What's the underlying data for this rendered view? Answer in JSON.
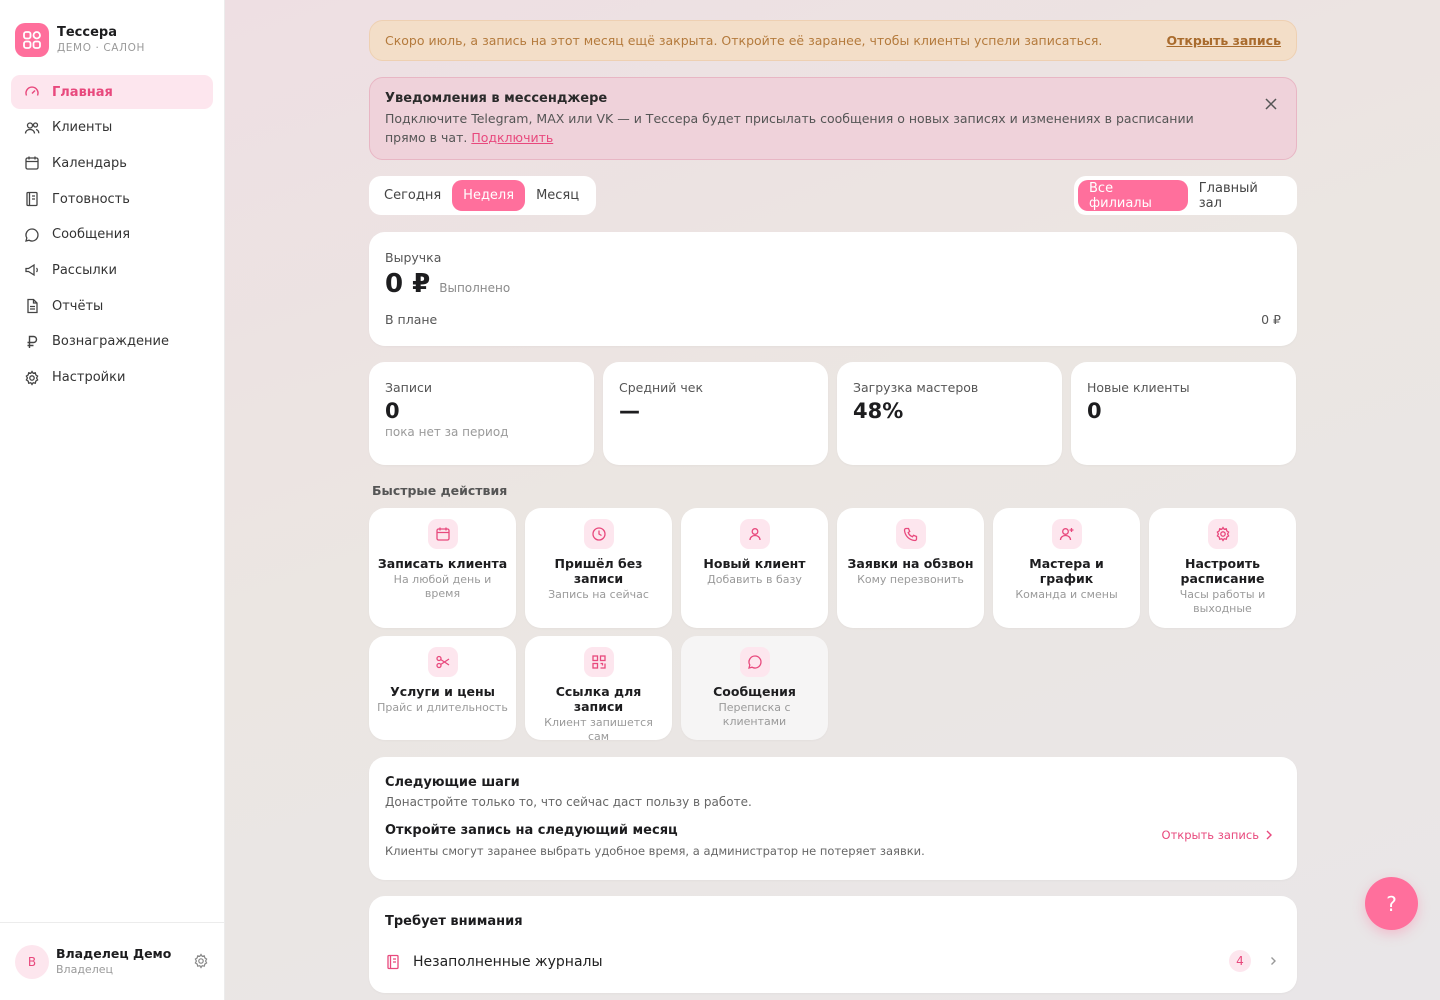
{
  "brand": {
    "name": "Тессера",
    "subtitle": "ДЕМО · САЛОН"
  },
  "nav": {
    "items": [
      {
        "label": "Главная",
        "icon": "gauge-icon",
        "active": true
      },
      {
        "label": "Клиенты",
        "icon": "users-icon"
      },
      {
        "label": "Календарь",
        "icon": "calendar-icon"
      },
      {
        "label": "Готовность",
        "icon": "notebook-icon"
      },
      {
        "label": "Сообщения",
        "icon": "chat-icon"
      },
      {
        "label": "Рассылки",
        "icon": "megaphone-icon"
      },
      {
        "label": "Отчёты",
        "icon": "report-icon"
      },
      {
        "label": "Вознаграждение",
        "icon": "ruble-icon"
      },
      {
        "label": "Настройки",
        "icon": "gear-icon"
      }
    ]
  },
  "user": {
    "initial": "В",
    "name": "Владелец Демо",
    "role": "Владелец"
  },
  "warning": {
    "text": "Скоро июль, а запись на этот месяц ещё закрыта. Откройте её заранее, чтобы клиенты успели записаться.",
    "link": "Открыть запись"
  },
  "notify": {
    "title": "Уведомления в мессенджере",
    "text": "Подключите Telegram, MAX или VK — и Тессера будет присылать сообщения о новых записях и изменениях в расписании прямо в чат.",
    "link": "Подключить"
  },
  "period": {
    "today": "Сегодня",
    "week": "Неделя",
    "month": "Месяц"
  },
  "branch": {
    "all": "Все филиалы",
    "main": "Главный зал"
  },
  "revenue": {
    "label": "Выручка",
    "value": "0 ₽",
    "done": "Выполнено",
    "plan_label": "В плане",
    "plan_value": "0 ₽"
  },
  "stats": [
    {
      "label": "Записи",
      "value": "0",
      "sub": "пока нет за период"
    },
    {
      "label": "Средний чек",
      "value": "—",
      "sub": ""
    },
    {
      "label": "Загрузка мастеров",
      "value": "48%",
      "sub": ""
    },
    {
      "label": "Новые клиенты",
      "value": "0",
      "sub": ""
    }
  ],
  "quick": {
    "title": "Быстрые действия",
    "actions": [
      {
        "title": "Записать клиента",
        "sub": "На любой день и время",
        "icon": "calendar-icon"
      },
      {
        "title": "Пришёл без записи",
        "sub": "Запись на сейчас",
        "icon": "clock-icon"
      },
      {
        "title": "Новый клиент",
        "sub": "Добавить в базу",
        "icon": "user-icon"
      },
      {
        "title": "Заявки на обзвон",
        "sub": "Кому перезвонить",
        "icon": "phone-icon"
      },
      {
        "title": "Мастера и график",
        "sub": "Команда и смены",
        "icon": "user-plus-icon"
      },
      {
        "title": "Настроить расписание",
        "sub": "Часы работы и выходные",
        "icon": "gear-icon"
      },
      {
        "title": "Услуги и цены",
        "sub": "Прайс и длительность",
        "icon": "scissors-icon"
      },
      {
        "title": "Ссылка для записи",
        "sub": "Клиент запишется сам",
        "icon": "qr-icon"
      },
      {
        "title": "Сообщения",
        "sub": "Переписка с клиентами",
        "icon": "chat-icon"
      }
    ]
  },
  "steps": {
    "title": "Следующие шаги",
    "sub": "Донастройте только то, что сейчас даст пользу в работе.",
    "item_title": "Откройте запись на следующий месяц",
    "item_desc": "Клиенты смогут заранее выбрать удобное время, а администратор не потеряет заявки.",
    "item_link": "Открыть запись"
  },
  "attention": {
    "title": "Требует внимания",
    "label": "Незаполненные журналы",
    "count": "4"
  },
  "help": {
    "label": "?"
  },
  "colors": {
    "accent": "#ff6f9c",
    "accent_dark": "#e8497d",
    "accent_soft": "#fde6ee",
    "warn_bg": "#f3dec8",
    "warn_text": "#b47a3c"
  }
}
